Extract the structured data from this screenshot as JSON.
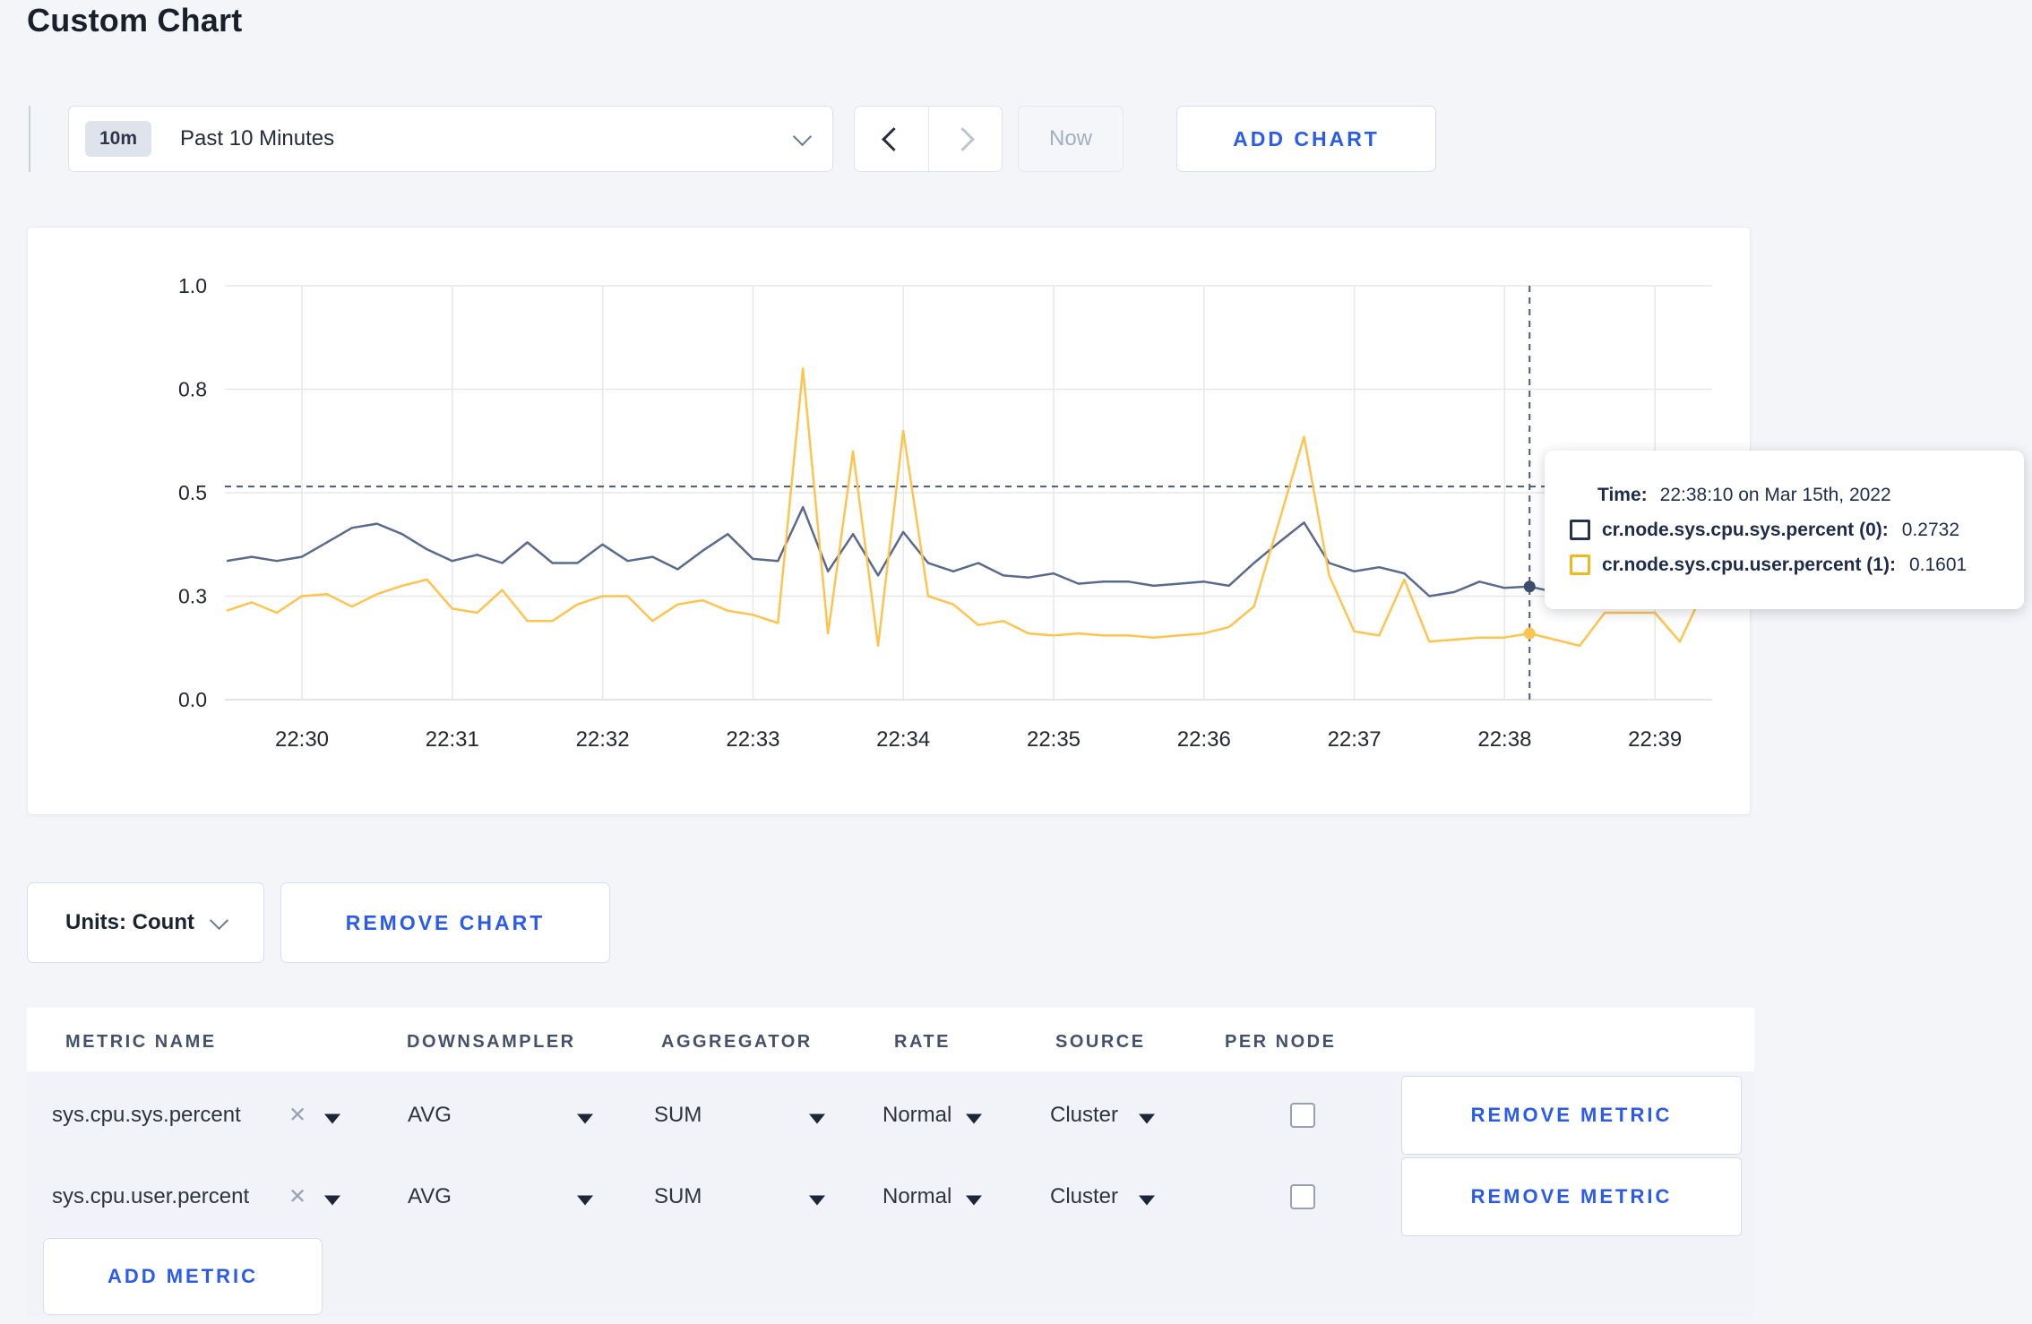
{
  "page": {
    "title": "Custom Chart"
  },
  "toolbar": {
    "time_window_badge": "10m",
    "time_window_label": "Past 10 Minutes",
    "now_label": "Now",
    "add_chart_label": "ADD CHART"
  },
  "chart_data": {
    "type": "line",
    "title": "",
    "ylabel": "",
    "xlabel": "",
    "y_range": [
      0,
      1
    ],
    "y_ticks": [
      "0.0",
      "0.3",
      "0.5",
      "0.8",
      "1.0"
    ],
    "x_ticks": [
      "22:30",
      "22:31",
      "22:32",
      "22:33",
      "22:34",
      "22:35",
      "22:36",
      "22:37",
      "22:38",
      "22:39"
    ],
    "start_time": "22:29:30",
    "interval_seconds": 10,
    "grid": true,
    "series": [
      {
        "name": "cr.node.sys.cpu.sys.percent (0)",
        "color": "#5a6a8c",
        "values": [
          0.335,
          0.345,
          0.335,
          0.345,
          0.38,
          0.415,
          0.425,
          0.4,
          0.363,
          0.335,
          0.35,
          0.33,
          0.38,
          0.33,
          0.33,
          0.375,
          0.335,
          0.345,
          0.315,
          0.36,
          0.4,
          0.34,
          0.335,
          0.465,
          0.31,
          0.4,
          0.3,
          0.405,
          0.33,
          0.31,
          0.33,
          0.3,
          0.295,
          0.305,
          0.28,
          0.285,
          0.285,
          0.275,
          0.28,
          0.285,
          0.275,
          0.33,
          0.38,
          0.428,
          0.33,
          0.31,
          0.32,
          0.305,
          0.25,
          0.26,
          0.285,
          0.27,
          0.2732,
          0.26,
          0.28,
          0.29,
          0.3,
          0.295,
          0.3,
          0.295
        ]
      },
      {
        "name": "cr.node.sys.cpu.user.percent (1)",
        "color": "#fdc44f",
        "values": [
          0.215,
          0.235,
          0.21,
          0.25,
          0.255,
          0.225,
          0.255,
          0.275,
          0.29,
          0.22,
          0.21,
          0.265,
          0.19,
          0.19,
          0.23,
          0.25,
          0.25,
          0.19,
          0.23,
          0.24,
          0.215,
          0.205,
          0.185,
          0.8,
          0.16,
          0.6,
          0.13,
          0.65,
          0.25,
          0.23,
          0.18,
          0.19,
          0.16,
          0.155,
          0.16,
          0.155,
          0.155,
          0.15,
          0.155,
          0.16,
          0.175,
          0.225,
          0.43,
          0.635,
          0.3,
          0.165,
          0.155,
          0.29,
          0.14,
          0.145,
          0.15,
          0.15,
          0.1601,
          0.145,
          0.13,
          0.21,
          0.21,
          0.21,
          0.14,
          0.27
        ]
      }
    ],
    "crosshair": {
      "index": 52,
      "time": "22:38:10",
      "horizontal_value": 0.515
    },
    "legend_position": "tooltip"
  },
  "tooltip": {
    "time_label": "Time:",
    "time_value": "22:38:10 on Mar 15th, 2022",
    "rows": [
      {
        "label": "cr.node.sys.cpu.sys.percent (0):",
        "value": "0.2732",
        "square_color": "#26334f"
      },
      {
        "label": "cr.node.sys.cpu.user.percent (1):",
        "value": "0.1601",
        "square_color": "#f3b71e"
      }
    ]
  },
  "chart_controls": {
    "units_label": "Units: Count",
    "remove_chart_label": "REMOVE CHART"
  },
  "metrics_table": {
    "headers": [
      "METRIC NAME",
      "DOWNSAMPLER",
      "AGGREGATOR",
      "RATE",
      "SOURCE",
      "PER NODE"
    ],
    "rows": [
      {
        "metric": "sys.cpu.sys.percent",
        "downsampler": "AVG",
        "aggregator": "SUM",
        "rate": "Normal",
        "source": "Cluster",
        "per_node_checked": false,
        "remove_label": "REMOVE METRIC"
      },
      {
        "metric": "sys.cpu.user.percent",
        "downsampler": "AVG",
        "aggregator": "SUM",
        "rate": "Normal",
        "source": "Cluster",
        "per_node_checked": false,
        "remove_label": "REMOVE METRIC"
      }
    ],
    "add_metric_label": "ADD METRIC"
  },
  "colors": {
    "accent_blue": "#2a5bec",
    "page_background": "#f4f5f9",
    "series_sys": "#5a6a8c",
    "series_user": "#fdc44f",
    "crosshair": "#4a5a73",
    "gridline": "#e7e7e7"
  }
}
